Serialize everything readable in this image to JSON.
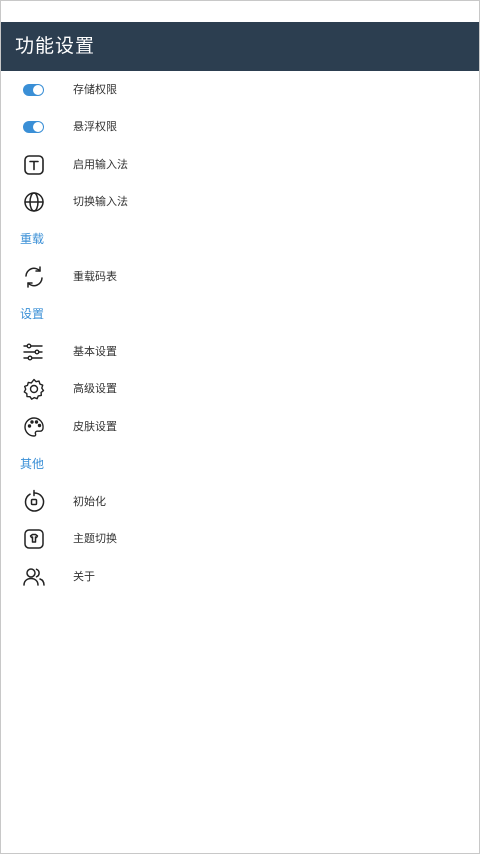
{
  "appbar": {
    "title": "功能设置"
  },
  "permissions": {
    "storage": {
      "label": "存储权限",
      "enabled": true
    },
    "overlay": {
      "label": "悬浮权限",
      "enabled": true
    },
    "enable_ime": {
      "label": "启用输入法",
      "icon": "text-box-icon"
    },
    "switch_ime": {
      "label": "切换输入法",
      "icon": "globe-icon"
    }
  },
  "reload": {
    "header": "重载",
    "reload_table": {
      "label": "重载码表",
      "icon": "refresh-icon"
    }
  },
  "settings": {
    "header": "设置",
    "basic": {
      "label": "基本设置",
      "icon": "sliders-icon"
    },
    "advanced": {
      "label": "高级设置",
      "icon": "gear-icon"
    },
    "skin": {
      "label": "皮肤设置",
      "icon": "palette-icon"
    }
  },
  "other": {
    "header": "其他",
    "init": {
      "label": "初始化",
      "icon": "reset-icon"
    },
    "theme": {
      "label": "主题切换",
      "icon": "shirt-icon"
    },
    "about": {
      "label": "关于",
      "icon": "users-icon"
    }
  },
  "colors": {
    "appbar": "#2c3e50",
    "accent": "#3a8fd6"
  }
}
